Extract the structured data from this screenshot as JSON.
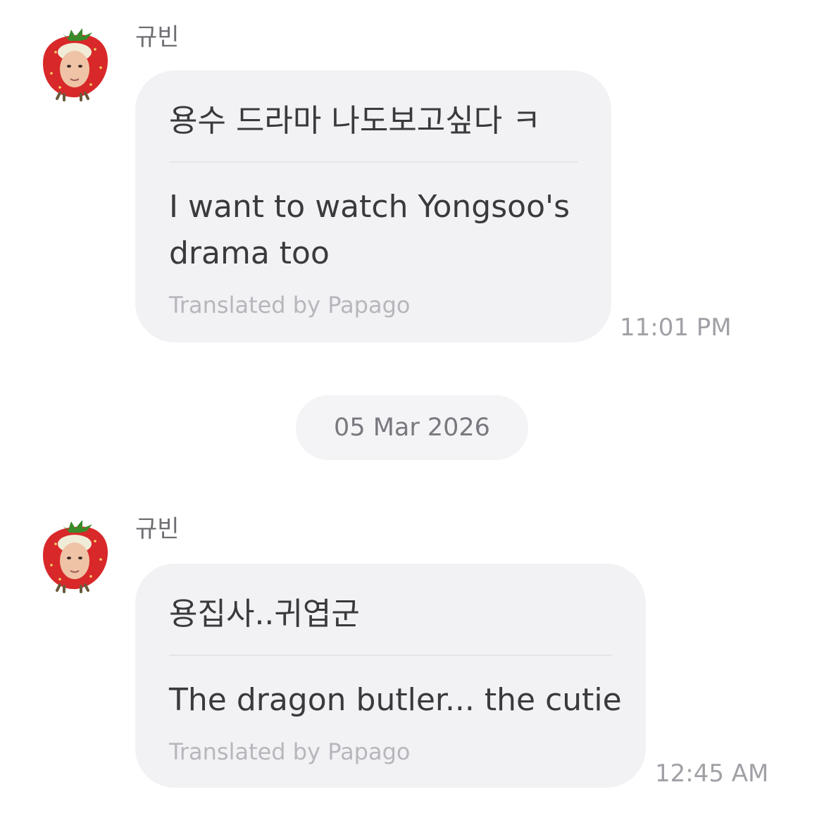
{
  "messages": [
    {
      "sender": "규빈",
      "original": "용수 드라마 나도보고싶다 ㅋ",
      "translated": "I want to watch Yongsoo's drama too",
      "credit": "Translated by Papago",
      "time": "11:01 PM"
    },
    {
      "sender": "규빈",
      "original": "용집사..귀엽군",
      "translated": "The dragon butler... the cutie",
      "credit": "Translated by Papago",
      "time": "12:45 AM"
    }
  ],
  "date_separator": "05 Mar 2026",
  "avatar_icon": "strawberry-face-avatar-icon",
  "colors": {
    "bubble": "#f2f2f5",
    "text": "#3a3a3c",
    "muted": "#a0a0a6",
    "strawberry": "#d8282a"
  }
}
